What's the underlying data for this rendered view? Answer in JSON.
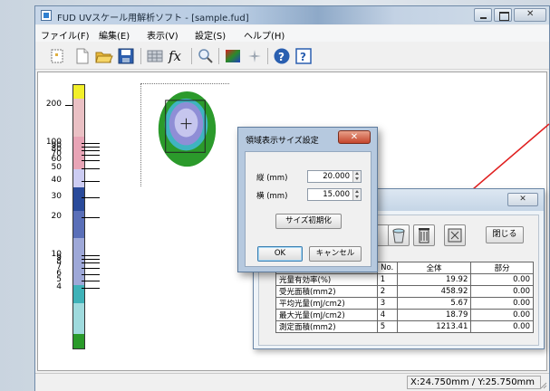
{
  "window": {
    "title": "FUD UVスケール用解析ソフト - [sample.fud]",
    "close_glyph": "✕"
  },
  "menu": [
    "ファイル(F)",
    "編集(E)",
    "表示(V)",
    "設定(S)",
    "ヘルプ(H)"
  ],
  "toolbar_icons": [
    "new-page-icon",
    "new-document-icon",
    "open-folder-icon",
    "save-disk-icon",
    "grid-icon",
    "function-fx-icon",
    "magnifier-icon",
    "color-map-icon",
    "sparkle-icon",
    "help-icon",
    "context-help-icon"
  ],
  "toolbar": {
    "fx": "fx",
    "help": "?"
  },
  "scale": {
    "labels": [
      "200",
      "100",
      "90",
      "80",
      "70",
      "60",
      "50",
      "40",
      "30",
      "20",
      "10",
      "9",
      "8",
      "7",
      "6",
      "5",
      "4"
    ],
    "colors": {
      "yellow": "#f2ef2a",
      "pink_light": "#eac0c4",
      "pink_band": "#e08aa0",
      "lavender": "#ccccf2",
      "navy": "#2a4a9a",
      "mid_blue": "#5a6fb8",
      "periwinkle": "#9ea8d8",
      "teal": "#3fb2b8",
      "light_teal": "#9fdadd",
      "green": "#2a9a2a"
    }
  },
  "size_dialog": {
    "title": "領域表示サイズ設定",
    "close": "✕",
    "height_label": "縦 (mm)",
    "height_value": "20.000",
    "width_label": "横 (mm)",
    "width_value": "15.000",
    "reset_button": "サイズ初期化",
    "ok_button": "OK",
    "cancel_button": "キャンセル"
  },
  "result_dialog": {
    "close": "✕",
    "close_button": "閉じる",
    "columns": [
      "",
      "No.",
      "全体",
      "部分"
    ],
    "rows": [
      {
        "name": "光量有効率(%)",
        "no": "1",
        "total": "19.92",
        "part": "0.00"
      },
      {
        "name": "受光面積(mm2)",
        "no": "2",
        "total": "458.92",
        "part": "0.00"
      },
      {
        "name": "平均光量(mJ/cm2)",
        "no": "3",
        "total": "5.67",
        "part": "0.00"
      },
      {
        "name": "最大光量(mJ/cm2)",
        "no": "4",
        "total": "18.79",
        "part": "0.00"
      },
      {
        "name": "測定面積(mm2)",
        "no": "5",
        "total": "1213.41",
        "part": "0.00"
      }
    ]
  },
  "status": {
    "coord": "X:24.750mm / Y:25.750mm"
  },
  "annotation": {
    "arrow_color": "#e02020"
  }
}
